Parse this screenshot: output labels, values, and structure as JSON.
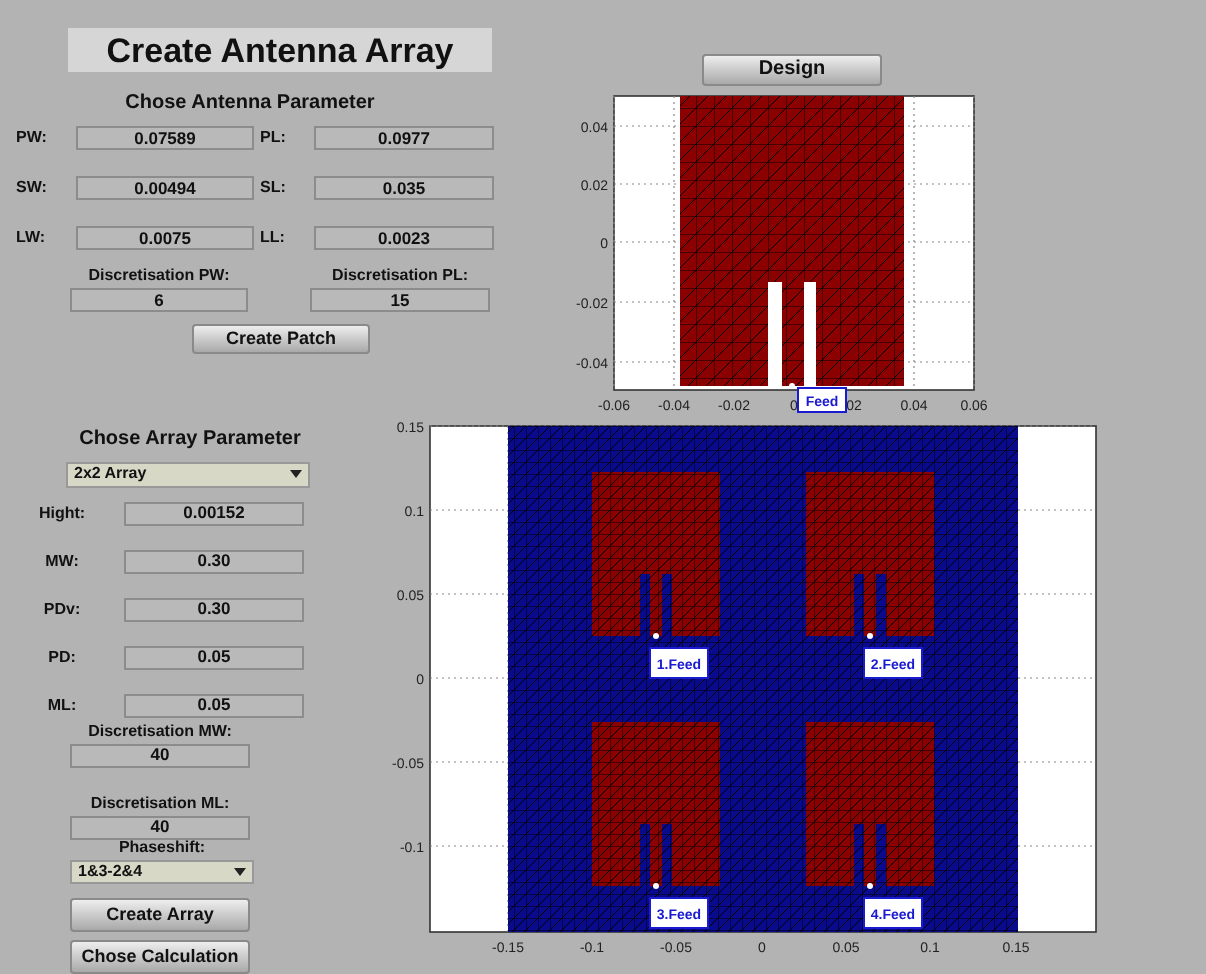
{
  "title": "Create Antenna Array",
  "antenna_parameters": {
    "heading": "Chose Antenna Parameter",
    "fields": [
      {
        "label": "PW:",
        "value": "0.07589"
      },
      {
        "label": "PL:",
        "value": "0.0977"
      },
      {
        "label": "SW:",
        "value": "0.00494"
      },
      {
        "label": "SL:",
        "value": "0.035"
      },
      {
        "label": "LW:",
        "value": "0.0075"
      },
      {
        "label": "LL:",
        "value": "0.0023"
      }
    ],
    "discretisation": [
      {
        "label": "Discretisation PW:",
        "value": "6"
      },
      {
        "label": "Discretisation PL:",
        "value": "15"
      }
    ],
    "button": "Create Patch"
  },
  "design_button": "Design",
  "patch_plot": {
    "yticks": [
      "0.04",
      "0.02",
      "0",
      "-0.02",
      "-0.04"
    ],
    "xticks": [
      "-0.06",
      "-0.04",
      "-0.02",
      "0",
      "02",
      "0.04",
      "0.06"
    ],
    "feed_label": "Feed"
  },
  "array_parameters": {
    "heading": "Chose Array Parameter",
    "array_type": "2x2 Array",
    "fields": [
      {
        "label": "Hight:",
        "value": "0.00152"
      },
      {
        "label": "MW:",
        "value": "0.30"
      },
      {
        "label": "PDv:",
        "value": "0.30"
      },
      {
        "label": "PD:",
        "value": "0.05"
      },
      {
        "label": "ML:",
        "value": "0.05"
      }
    ],
    "discretisation": [
      {
        "label": "Discretisation MW:",
        "value": "40"
      },
      {
        "label": "Discretisation ML:",
        "value": "40"
      }
    ],
    "phaseshift_label": "Phaseshift:",
    "phaseshift": "1&3-2&4",
    "buttons": [
      "Create Array",
      "Chose Calculation"
    ]
  },
  "array_plot": {
    "yticks": [
      "0.15",
      "0.1",
      "0.05",
      "0",
      "-0.05",
      "-0.1"
    ],
    "xticks": [
      "-0.15",
      "-0.1",
      "-0.05",
      "0",
      "0.05",
      "0.1",
      "0.15"
    ],
    "feed_labels": [
      "1.Feed",
      "2.Feed",
      "3.Feed",
      "4.Feed"
    ]
  }
}
